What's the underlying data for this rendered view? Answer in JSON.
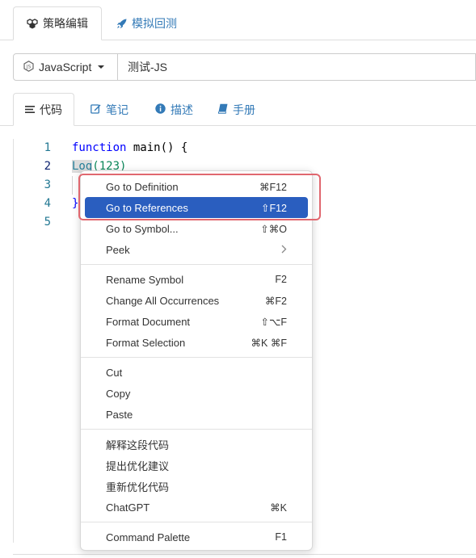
{
  "top_tabs": [
    {
      "label": "策略编辑",
      "icon": "cubes-icon",
      "active": true
    },
    {
      "label": "模拟回测",
      "icon": "rocket-icon",
      "active": false
    }
  ],
  "language_select": {
    "value": "JavaScript"
  },
  "strategy_name": {
    "value": "测试-JS"
  },
  "sub_tabs": [
    {
      "label": "代码",
      "icon": "list-icon",
      "active": true
    },
    {
      "label": "笔记",
      "icon": "edit-icon",
      "active": false
    },
    {
      "label": "描述",
      "icon": "info-icon",
      "active": false
    },
    {
      "label": "手册",
      "icon": "book-icon",
      "active": false
    }
  ],
  "editor": {
    "line_numbers": [
      "1",
      "2",
      "3",
      "4",
      "5"
    ],
    "lines": {
      "l1_kw": "function",
      "l1_rest": " main() {",
      "l2_ident": "Log",
      "l2_rest": "(123)",
      "l4": "}"
    }
  },
  "context_menu": {
    "group1": [
      {
        "label": "Go to Definition",
        "shortcut": "⌘F12"
      },
      {
        "label": "Go to References",
        "shortcut": "⇧F12",
        "selected": true
      },
      {
        "label": "Go to Symbol...",
        "shortcut": "⇧⌘O"
      },
      {
        "label": "Peek",
        "shortcut": ""
      }
    ],
    "group2": [
      {
        "label": "Rename Symbol",
        "shortcut": "F2"
      },
      {
        "label": "Change All Occurrences",
        "shortcut": "⌘F2"
      },
      {
        "label": "Format Document",
        "shortcut": "⇧⌥F"
      },
      {
        "label": "Format Selection",
        "shortcut": "⌘K ⌘F"
      }
    ],
    "group3": [
      {
        "label": "Cut"
      },
      {
        "label": "Copy"
      },
      {
        "label": "Paste"
      }
    ],
    "group4": [
      {
        "label": "解释这段代码",
        "shortcut": ""
      },
      {
        "label": "提出优化建议",
        "shortcut": ""
      },
      {
        "label": "重新优化代码",
        "shortcut": ""
      },
      {
        "label": "ChatGPT",
        "shortcut": "⌘K"
      }
    ],
    "group5": [
      {
        "label": "Command Palette",
        "shortcut": "F1"
      }
    ]
  },
  "colors": {
    "link": "#337ab7",
    "selected_menu_bg": "#2a5ebf",
    "highlight_border": "#e0676f"
  }
}
